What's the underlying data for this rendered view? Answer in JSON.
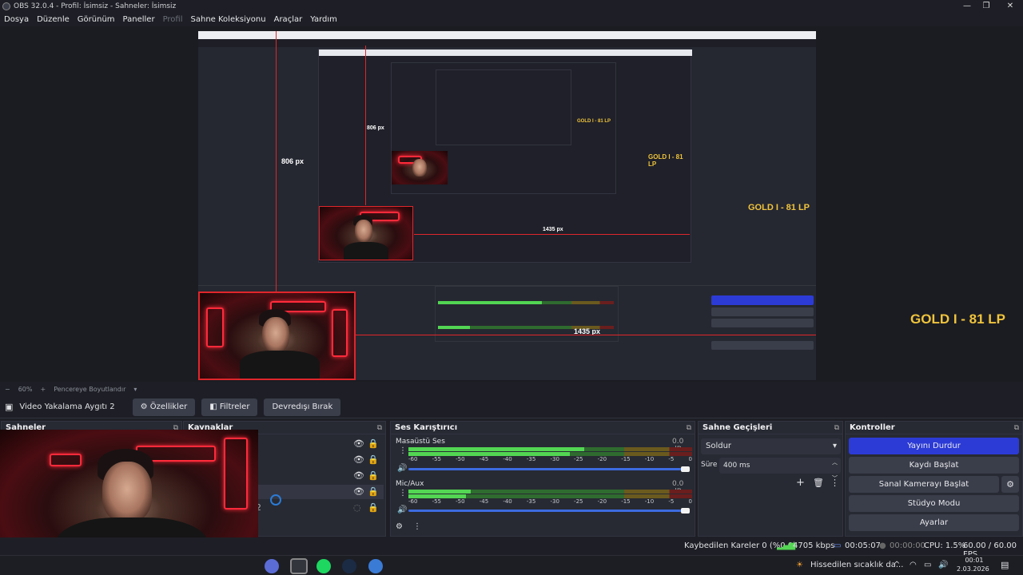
{
  "window": {
    "title": "OBS 32.0.4 - Profil: İsimsiz - Sahneler: İsimsiz",
    "minimize": "—",
    "maximize": "❐",
    "close": "✕"
  },
  "menu": [
    {
      "label": "Dosya",
      "enabled": true
    },
    {
      "label": "Düzenle",
      "enabled": true
    },
    {
      "label": "Görünüm",
      "enabled": true
    },
    {
      "label": "Paneller",
      "enabled": true
    },
    {
      "label": "Profil",
      "enabled": false
    },
    {
      "label": "Sahne Koleksiyonu",
      "enabled": true
    },
    {
      "label": "Araçlar",
      "enabled": true
    },
    {
      "label": "Yardım",
      "enabled": true
    }
  ],
  "preview": {
    "overlay_text": "GOLD I - 81 LP",
    "measure_vertical": "806 px",
    "measure_horizontal": "1435 px",
    "measure_vertical_small": "806 px"
  },
  "zoom": {
    "percent": "60%",
    "fit_label": "Pencereye Boyutlandır"
  },
  "source_toolbar": {
    "source_name": "Video Yakalama Aygıtı 2",
    "properties": "Özellikler",
    "filters": "Filtreler",
    "deactivate": "Devredışı Bırak"
  },
  "docks": {
    "scenes": "Sahneler",
    "sources": "Kaynaklar",
    "mixer": "Ses Karıştırıcı",
    "transitions": "Sahne Geçişleri",
    "controls": "Kontroller"
  },
  "sources_hidden_digit": "2",
  "mixer": {
    "channels": [
      {
        "name": "Masaüstü Ses",
        "db": "0.0 dB",
        "level": 0.62,
        "volume": 1.0
      },
      {
        "name": "Mic/Aux",
        "db": "0.0 dB",
        "level": 0.22,
        "volume": 1.0
      }
    ],
    "ticks": [
      "-60",
      "-55",
      "-50",
      "-45",
      "-40",
      "-35",
      "-30",
      "-25",
      "-20",
      "-15",
      "-10",
      "-5",
      "0"
    ]
  },
  "transitions": {
    "selected": "Soldur",
    "duration_label": "Süre",
    "duration_value": "400 ms"
  },
  "controls": {
    "stop_stream": "Yayını Durdur",
    "start_record": "Kaydı Başlat",
    "virtual_cam": "Sanal Kamerayı Başlat",
    "studio_mode": "Stüdyo Modu",
    "settings": "Ayarlar"
  },
  "status": {
    "dropped_frames": "Kaybedilen Kareler 0 (%0.0)",
    "bitrate": "4705 kbps",
    "stream_time": "00:05:07",
    "record_time": "00:00:00",
    "cpu": "CPU: 1.5%",
    "fps": "60.00 / 60.00 FPS"
  },
  "taskbar": {
    "weather": "Hissedilen sıcaklık da...",
    "time": "00:01",
    "date": "2.03.2026"
  },
  "colors": {
    "accent": "#2c3bd6",
    "meter_green": "#53d653",
    "gold": "#f0c43c",
    "guide_red": "#e0262b"
  }
}
